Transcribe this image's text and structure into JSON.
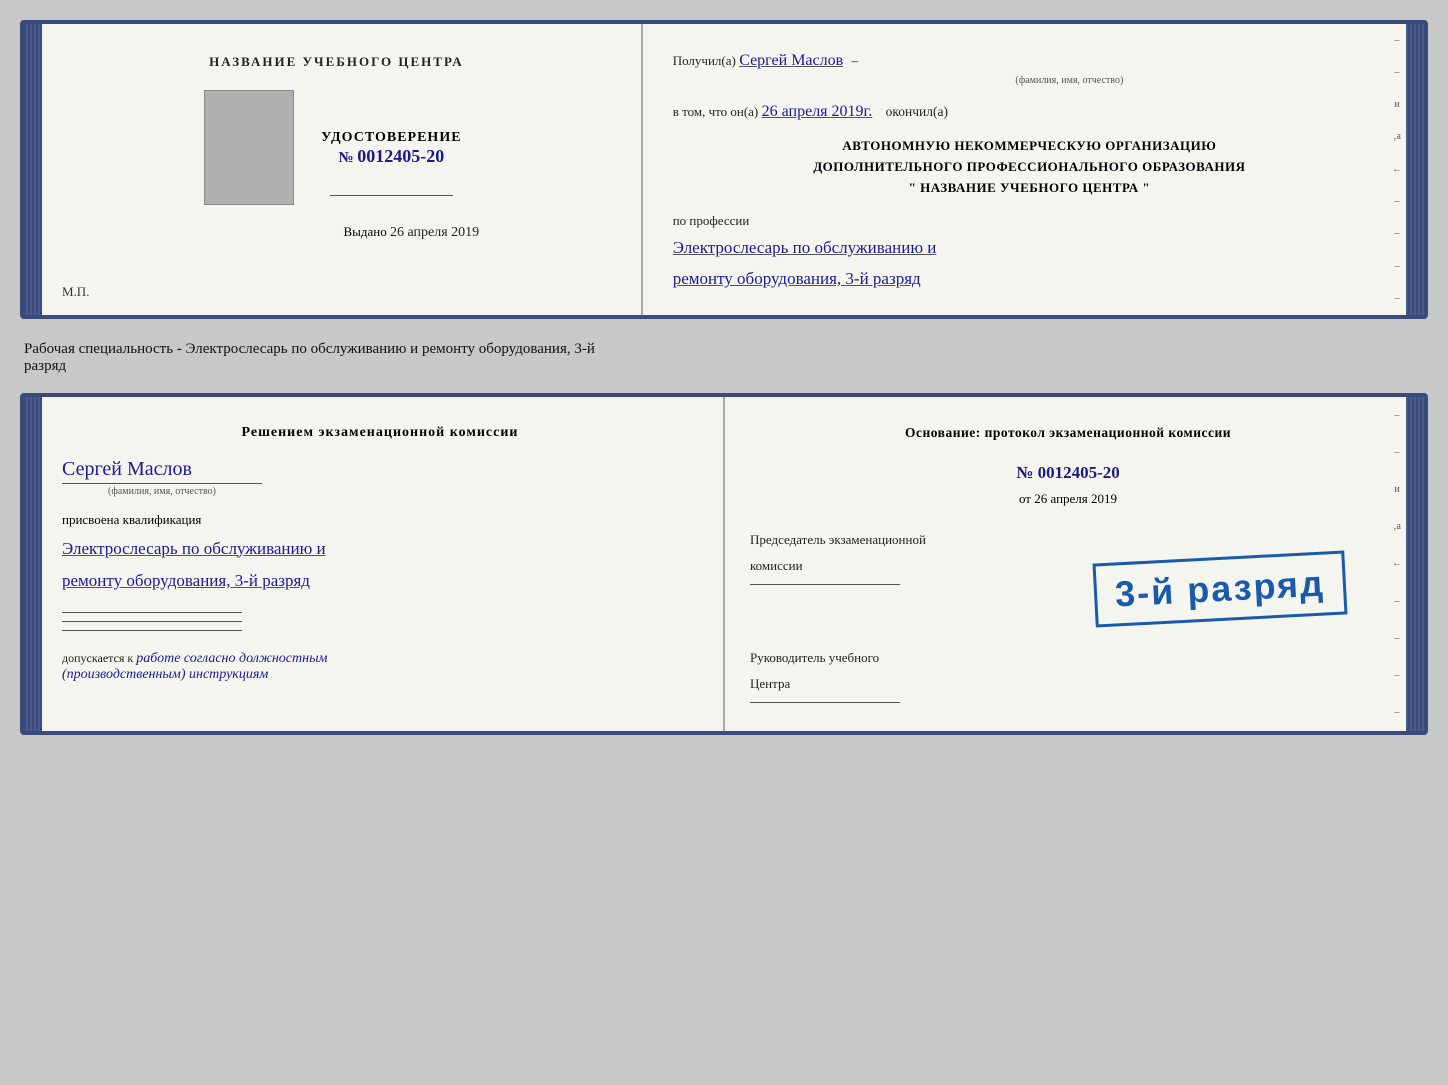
{
  "card1": {
    "left": {
      "center_title": "НАЗВАНИЕ УЧЕБНОГО ЦЕНТРА",
      "cert_label": "УДОСТОВЕРЕНИЕ",
      "cert_number_prefix": "№",
      "cert_number": "0012405-20",
      "issued_label": "Выдано",
      "issued_date": "26 апреля 2019",
      "mp_label": "М.П."
    },
    "right": {
      "received_label": "Получил(а)",
      "received_name": "Сергей Маслов",
      "fio_sublabel": "(фамилия, имя, отчество)",
      "in_that_label": "в том, что он(а)",
      "in_that_date": "26 апреля 2019г.",
      "finished_label": "окончил(а)",
      "org_line1": "АВТОНОМНУЮ НЕКОММЕРЧЕСКУЮ ОРГАНИЗАЦИЮ",
      "org_line2": "ДОПОЛНИТЕЛЬНОГО ПРОФЕССИОНАЛЬНОГО ОБРАЗОВАНИЯ",
      "org_line3": "\" НАЗВАНИЕ УЧЕБНОГО ЦЕНТРА \"",
      "profession_label": "по профессии",
      "profession_hw_line1": "Электрослесарь по обслуживанию и",
      "profession_hw_line2": "ремонту оборудования, 3-й разряд"
    }
  },
  "caption": "Рабочая специальность - Электрослесарь по обслуживанию и ремонту оборудования, 3-й\nразряд",
  "card2": {
    "left": {
      "decision_title": "Решением экзаменационной комиссии",
      "person_name": "Сергей Маслов",
      "fio_sublabel": "(фамилия, имя, отчество)",
      "qualification_assigned": "присвоена квалификация",
      "qualification_hw_line1": "Электрослесарь по обслуживанию и",
      "qualification_hw_line2": "ремонту оборудования, 3-й разряд",
      "admits_label": "допускается к",
      "admits_hw": "работе согласно должностным\n(производственным) инструкциям"
    },
    "right": {
      "basis_label": "Основание: протокол экзаменационной комиссии",
      "protocol_number": "№  0012405-20",
      "date_label": "от",
      "date_value": "26 апреля 2019",
      "chairman_label": "Председатель экзаменационной\nкомиссии",
      "stamp_text": "3-й разряд",
      "leader_label": "Руководитель учебного\nЦентра"
    }
  }
}
